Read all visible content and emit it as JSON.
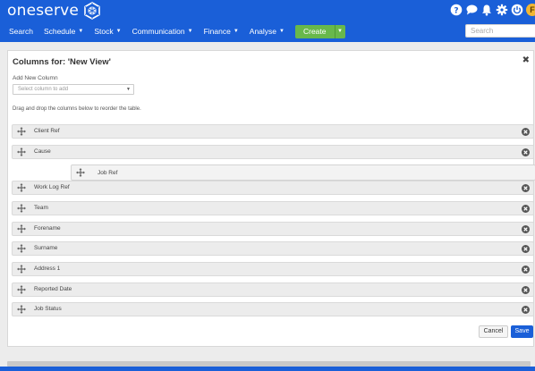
{
  "app": {
    "logo_text": "oneserve"
  },
  "nav": {
    "items": [
      {
        "label": "Search",
        "dropdown": false
      },
      {
        "label": "Schedule",
        "dropdown": true
      },
      {
        "label": "Stock",
        "dropdown": true
      },
      {
        "label": "Communication",
        "dropdown": true
      },
      {
        "label": "Finance",
        "dropdown": true
      },
      {
        "label": "Analyse",
        "dropdown": true
      }
    ],
    "create_label": "Create",
    "search_placeholder": "Search"
  },
  "header_icons": [
    "help-icon",
    "chat-icon",
    "bell-icon",
    "gear-icon",
    "power-icon",
    "avatar"
  ],
  "avatar_initial": "F",
  "panel": {
    "title": "Columns for: 'New View'",
    "add_label": "Add New Column",
    "select_placeholder": "Select column to add",
    "hint": "Drag and drop the columns below to reorder the table.",
    "columns": [
      "Client Ref",
      "Cause",
      "Work Log Ref",
      "Team",
      "Forename",
      "Surname",
      "Address 1",
      "Reported Date",
      "Job Status"
    ],
    "dragging_column": "Job Ref",
    "cancel_label": "Cancel",
    "save_label": "Save"
  },
  "colors": {
    "brand_blue": "#1a5fd8",
    "create_green": "#68b84b"
  }
}
